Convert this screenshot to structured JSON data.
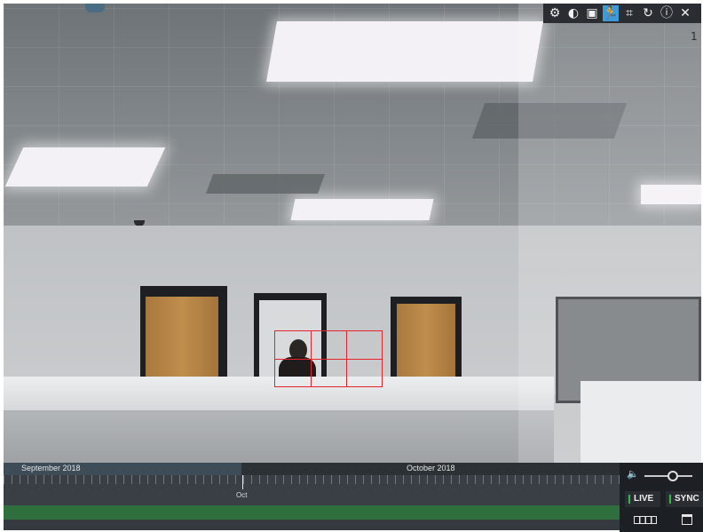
{
  "toolbar": {
    "buttons": [
      {
        "name": "settings",
        "glyph": "⚙"
      },
      {
        "name": "contrast",
        "glyph": "◐"
      },
      {
        "name": "snapshot",
        "glyph": "▣"
      },
      {
        "name": "motion",
        "glyph": "🏃"
      },
      {
        "name": "fit",
        "glyph": "⌗"
      },
      {
        "name": "rotate",
        "glyph": "↻"
      },
      {
        "name": "info",
        "glyph": "ⓘ"
      },
      {
        "name": "close",
        "glyph": "✕"
      }
    ],
    "active_button": "motion",
    "active_color": "#3f9bd6"
  },
  "camera": {
    "number": "1"
  },
  "timeline": {
    "months": [
      "September 2018",
      "October 2018"
    ],
    "cursor_label": "Oct",
    "record_color": "#2f6f3d"
  },
  "controls": {
    "volume_level": 0.6,
    "live_label": "LIVE",
    "sync_label": "SYNC",
    "indicator_color": "#39b54a"
  },
  "motion_overlay_color": "#e8232b"
}
